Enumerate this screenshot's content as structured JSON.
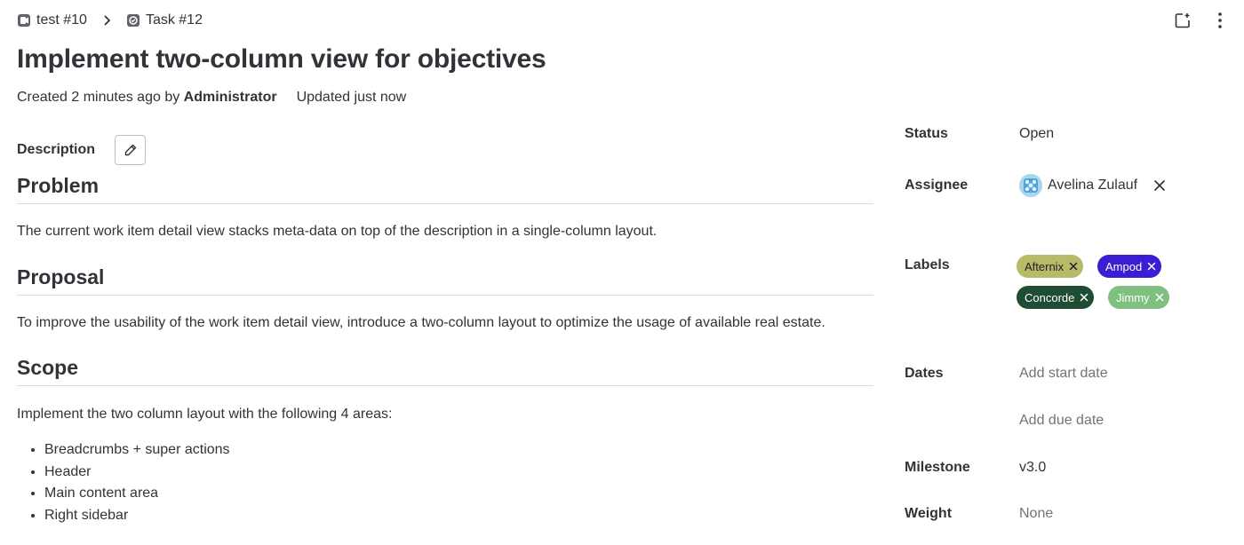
{
  "breadcrumb": {
    "items": [
      {
        "label": "test #10",
        "icon": "objective-icon"
      },
      {
        "label": "Task #12",
        "icon": "task-icon"
      }
    ]
  },
  "top_actions": {
    "icons": [
      "new-note-icon",
      "more-vertical-icon"
    ]
  },
  "header": {
    "title": "Implement two-column view for objectives",
    "created_prefix": "Created 2 minutes ago by",
    "author": "Administrator",
    "updated": "Updated just now"
  },
  "description": {
    "label": "Description",
    "edit_icon": "pencil-icon",
    "sections": [
      {
        "heading": "Problem",
        "text": "The current work item detail view stacks meta-data on top of the description in a single-column layout."
      },
      {
        "heading": "Proposal",
        "text": "To improve the usability of the work item detail view, introduce a two-column layout to optimize the usage of available real estate."
      },
      {
        "heading": "Scope",
        "text": "Implement the two column layout with the following 4 areas:"
      }
    ],
    "scope_items": [
      "Breadcrumbs + super actions",
      "Header",
      "Main content area",
      "Right sidebar"
    ]
  },
  "sidebar": {
    "status": {
      "label": "Status",
      "value": "Open"
    },
    "assignee": {
      "label": "Assignee",
      "name": "Avelina Zulauf"
    },
    "labels": {
      "label": "Labels",
      "items": [
        {
          "name": "Afternix",
          "bg": "#b9b96a",
          "fg": "#1f1e24"
        },
        {
          "name": "Ampod",
          "bg": "#3a1ed1",
          "fg": "#ffffff"
        },
        {
          "name": "Concorde",
          "bg": "#1f4d33",
          "fg": "#ffffff"
        },
        {
          "name": "Jimmy",
          "bg": "#7fbf7f",
          "fg": "#ffffff"
        }
      ]
    },
    "dates": {
      "label": "Dates",
      "start_placeholder": "Add start date",
      "due_placeholder": "Add due date"
    },
    "milestone": {
      "label": "Milestone",
      "value": "v3.0"
    },
    "weight": {
      "label": "Weight",
      "value": "None"
    }
  }
}
